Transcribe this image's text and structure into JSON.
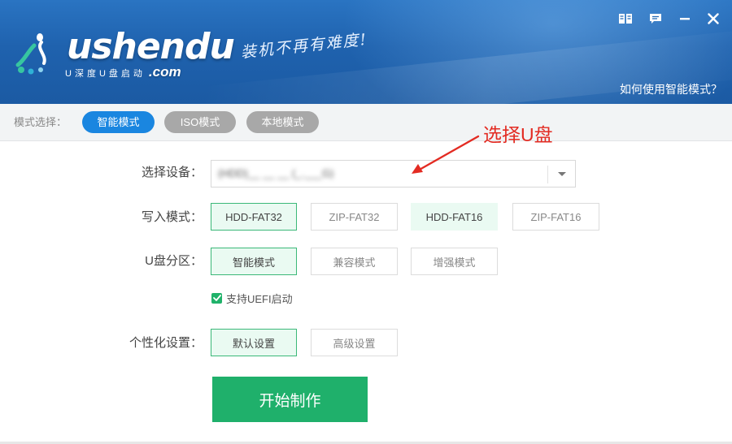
{
  "header": {
    "logo_text": "ushendu",
    "logo_sub_cn": "U深度U盘启动",
    "logo_sub_com": ".com",
    "slogan": "装机不再有难度!",
    "help_link": "如何使用智能模式？",
    "colors": {
      "banner": "#1f62ae",
      "text": "#ffffff"
    },
    "window_icons": [
      "book-icon",
      "message-icon",
      "minimize-icon",
      "close-icon"
    ]
  },
  "mode_bar": {
    "label": "模式选择：",
    "modes": [
      {
        "label": "智能模式",
        "selected": true
      },
      {
        "label": "ISO模式",
        "selected": false
      },
      {
        "label": "本地模式",
        "selected": false
      }
    ],
    "colors": {
      "selected": "#1a86e0",
      "unselected": "#a8a8a8"
    }
  },
  "form": {
    "device": {
      "label": "选择设备：",
      "value": "(HDD)__ __ __ (_.___G)"
    },
    "write_mode": {
      "label": "写入模式：",
      "options": [
        "HDD-FAT32",
        "ZIP-FAT32",
        "HDD-FAT16",
        "ZIP-FAT16"
      ],
      "selected": "HDD-FAT32"
    },
    "partition": {
      "label": "U盘分区：",
      "options": [
        "智能模式",
        "兼容模式",
        "增强模式"
      ],
      "selected": "智能模式"
    },
    "uefi": {
      "label": "支持UEFI启动",
      "checked": true
    },
    "personalization": {
      "label": "个性化设置：",
      "options": [
        "默认设置",
        "高级设置"
      ],
      "selected": "默认设置"
    },
    "start_button": "开始制作",
    "colors": {
      "accent_green": "#1fb06b",
      "selected_bg": "#eafaf2"
    }
  },
  "annotation": {
    "text": "选择U盘",
    "color": "#e32b22"
  }
}
